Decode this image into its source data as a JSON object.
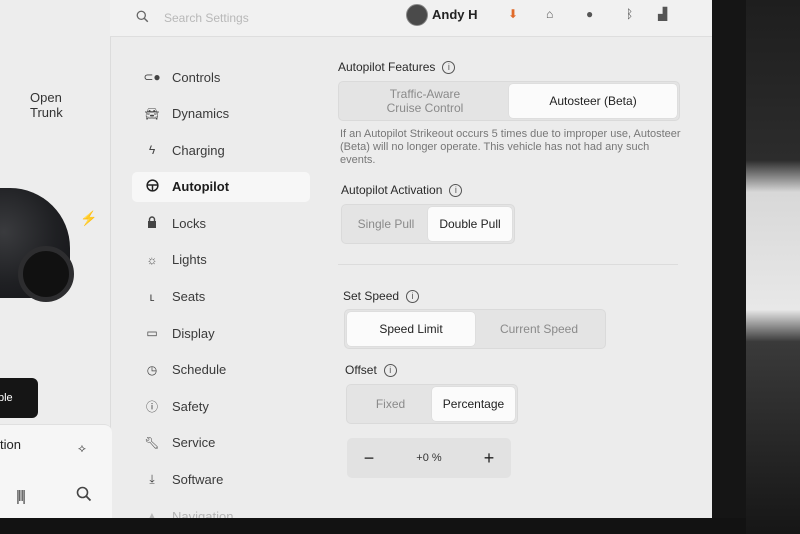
{
  "topbar": {
    "search_placeholder": "Search Settings",
    "user_name": "Andy H"
  },
  "car_panel": {
    "open_trunk": "Open Trunk",
    "unlock_badge": "ble",
    "bottom_card_label": "tion"
  },
  "nav": {
    "items": [
      {
        "label": "Controls",
        "icon": "toggle-icon"
      },
      {
        "label": "Dynamics",
        "icon": "car-icon"
      },
      {
        "label": "Charging",
        "icon": "bolt-icon"
      },
      {
        "label": "Autopilot",
        "icon": "steering-wheel-icon",
        "active": true
      },
      {
        "label": "Locks",
        "icon": "lock-icon"
      },
      {
        "label": "Lights",
        "icon": "sun-icon"
      },
      {
        "label": "Seats",
        "icon": "seat-icon"
      },
      {
        "label": "Display",
        "icon": "display-icon"
      },
      {
        "label": "Schedule",
        "icon": "clock-icon"
      },
      {
        "label": "Safety",
        "icon": "safety-icon"
      },
      {
        "label": "Service",
        "icon": "wrench-icon"
      },
      {
        "label": "Software",
        "icon": "download-icon"
      },
      {
        "label": "Navigation",
        "icon": "navigation-icon"
      }
    ]
  },
  "autopilot_features": {
    "label": "Autopilot Features",
    "options": [
      "Traffic-Aware Cruise Control",
      "Autosteer (Beta)"
    ],
    "selected": "Autosteer (Beta)",
    "warning": "If an Autopilot Strikeout occurs 5 times due to improper use, Autosteer (Beta) will no longer operate. This vehicle has not had any such events."
  },
  "autopilot_activation": {
    "label": "Autopilot Activation",
    "options": [
      "Single Pull",
      "Double Pull"
    ],
    "selected": "Double Pull"
  },
  "set_speed": {
    "label": "Set Speed",
    "options": [
      "Speed Limit",
      "Current Speed"
    ],
    "selected": "Speed Limit"
  },
  "offset": {
    "label": "Offset",
    "options": [
      "Fixed",
      "Percentage"
    ],
    "selected": "Percentage",
    "value": "+0 %",
    "minus": "−",
    "plus": "+"
  }
}
